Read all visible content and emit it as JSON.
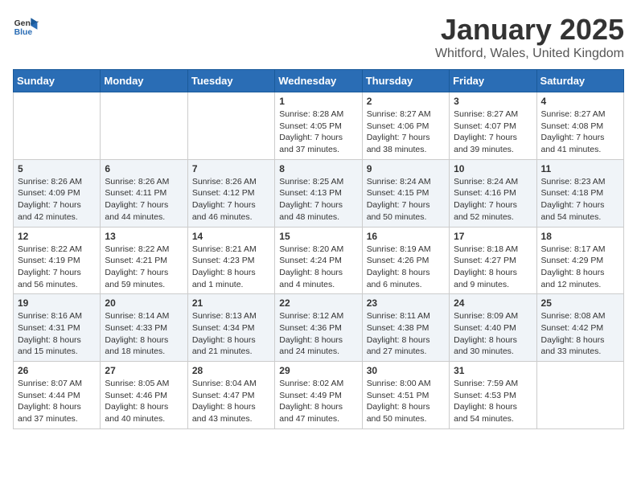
{
  "header": {
    "logo_general": "General",
    "logo_blue": "Blue",
    "title": "January 2025",
    "subtitle": "Whitford, Wales, United Kingdom"
  },
  "calendar": {
    "days_of_week": [
      "Sunday",
      "Monday",
      "Tuesday",
      "Wednesday",
      "Thursday",
      "Friday",
      "Saturday"
    ],
    "weeks": [
      [
        {
          "day": "",
          "detail": ""
        },
        {
          "day": "",
          "detail": ""
        },
        {
          "day": "",
          "detail": ""
        },
        {
          "day": "1",
          "detail": "Sunrise: 8:28 AM\nSunset: 4:05 PM\nDaylight: 7 hours\nand 37 minutes."
        },
        {
          "day": "2",
          "detail": "Sunrise: 8:27 AM\nSunset: 4:06 PM\nDaylight: 7 hours\nand 38 minutes."
        },
        {
          "day": "3",
          "detail": "Sunrise: 8:27 AM\nSunset: 4:07 PM\nDaylight: 7 hours\nand 39 minutes."
        },
        {
          "day": "4",
          "detail": "Sunrise: 8:27 AM\nSunset: 4:08 PM\nDaylight: 7 hours\nand 41 minutes."
        }
      ],
      [
        {
          "day": "5",
          "detail": "Sunrise: 8:26 AM\nSunset: 4:09 PM\nDaylight: 7 hours\nand 42 minutes."
        },
        {
          "day": "6",
          "detail": "Sunrise: 8:26 AM\nSunset: 4:11 PM\nDaylight: 7 hours\nand 44 minutes."
        },
        {
          "day": "7",
          "detail": "Sunrise: 8:26 AM\nSunset: 4:12 PM\nDaylight: 7 hours\nand 46 minutes."
        },
        {
          "day": "8",
          "detail": "Sunrise: 8:25 AM\nSunset: 4:13 PM\nDaylight: 7 hours\nand 48 minutes."
        },
        {
          "day": "9",
          "detail": "Sunrise: 8:24 AM\nSunset: 4:15 PM\nDaylight: 7 hours\nand 50 minutes."
        },
        {
          "day": "10",
          "detail": "Sunrise: 8:24 AM\nSunset: 4:16 PM\nDaylight: 7 hours\nand 52 minutes."
        },
        {
          "day": "11",
          "detail": "Sunrise: 8:23 AM\nSunset: 4:18 PM\nDaylight: 7 hours\nand 54 minutes."
        }
      ],
      [
        {
          "day": "12",
          "detail": "Sunrise: 8:22 AM\nSunset: 4:19 PM\nDaylight: 7 hours\nand 56 minutes."
        },
        {
          "day": "13",
          "detail": "Sunrise: 8:22 AM\nSunset: 4:21 PM\nDaylight: 7 hours\nand 59 minutes."
        },
        {
          "day": "14",
          "detail": "Sunrise: 8:21 AM\nSunset: 4:23 PM\nDaylight: 8 hours\nand 1 minute."
        },
        {
          "day": "15",
          "detail": "Sunrise: 8:20 AM\nSunset: 4:24 PM\nDaylight: 8 hours\nand 4 minutes."
        },
        {
          "day": "16",
          "detail": "Sunrise: 8:19 AM\nSunset: 4:26 PM\nDaylight: 8 hours\nand 6 minutes."
        },
        {
          "day": "17",
          "detail": "Sunrise: 8:18 AM\nSunset: 4:27 PM\nDaylight: 8 hours\nand 9 minutes."
        },
        {
          "day": "18",
          "detail": "Sunrise: 8:17 AM\nSunset: 4:29 PM\nDaylight: 8 hours\nand 12 minutes."
        }
      ],
      [
        {
          "day": "19",
          "detail": "Sunrise: 8:16 AM\nSunset: 4:31 PM\nDaylight: 8 hours\nand 15 minutes."
        },
        {
          "day": "20",
          "detail": "Sunrise: 8:14 AM\nSunset: 4:33 PM\nDaylight: 8 hours\nand 18 minutes."
        },
        {
          "day": "21",
          "detail": "Sunrise: 8:13 AM\nSunset: 4:34 PM\nDaylight: 8 hours\nand 21 minutes."
        },
        {
          "day": "22",
          "detail": "Sunrise: 8:12 AM\nSunset: 4:36 PM\nDaylight: 8 hours\nand 24 minutes."
        },
        {
          "day": "23",
          "detail": "Sunrise: 8:11 AM\nSunset: 4:38 PM\nDaylight: 8 hours\nand 27 minutes."
        },
        {
          "day": "24",
          "detail": "Sunrise: 8:09 AM\nSunset: 4:40 PM\nDaylight: 8 hours\nand 30 minutes."
        },
        {
          "day": "25",
          "detail": "Sunrise: 8:08 AM\nSunset: 4:42 PM\nDaylight: 8 hours\nand 33 minutes."
        }
      ],
      [
        {
          "day": "26",
          "detail": "Sunrise: 8:07 AM\nSunset: 4:44 PM\nDaylight: 8 hours\nand 37 minutes."
        },
        {
          "day": "27",
          "detail": "Sunrise: 8:05 AM\nSunset: 4:46 PM\nDaylight: 8 hours\nand 40 minutes."
        },
        {
          "day": "28",
          "detail": "Sunrise: 8:04 AM\nSunset: 4:47 PM\nDaylight: 8 hours\nand 43 minutes."
        },
        {
          "day": "29",
          "detail": "Sunrise: 8:02 AM\nSunset: 4:49 PM\nDaylight: 8 hours\nand 47 minutes."
        },
        {
          "day": "30",
          "detail": "Sunrise: 8:00 AM\nSunset: 4:51 PM\nDaylight: 8 hours\nand 50 minutes."
        },
        {
          "day": "31",
          "detail": "Sunrise: 7:59 AM\nSunset: 4:53 PM\nDaylight: 8 hours\nand 54 minutes."
        },
        {
          "day": "",
          "detail": ""
        }
      ]
    ]
  }
}
